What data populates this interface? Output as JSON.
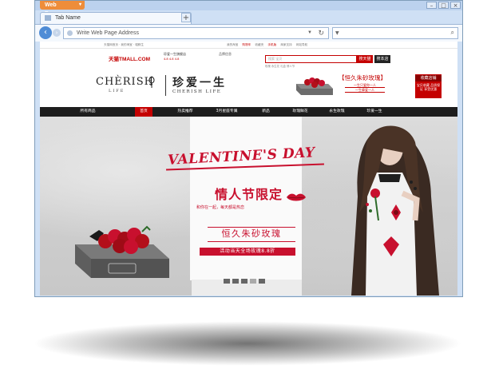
{
  "browser": {
    "app_title": "Web Browser",
    "tab_title": "Tab Name",
    "new_tab": "+",
    "address_placeholder": "Write Web Page Address"
  },
  "site": {
    "topbar_left": "天猫网首页 · 我的淘宝 · 喵鲜生",
    "topbar_right": [
      "我的淘宝",
      "购物车",
      "收藏夹",
      "手机版",
      "商家支持",
      "网站导航"
    ],
    "tmall_logo": "天猫TMALL.COM",
    "shop_name": "珍爱一生旗舰店",
    "shop_scores": "4.8 4.8 4.8",
    "shop_info": "品牌信息",
    "search_placeholder": "搜索 宝贝",
    "search_all_label": "搜天猫",
    "search_shop_label": "搜本店",
    "hot_words": "玫瑰 永生花 礼盒 情人节",
    "brand_en": "CHÈRISH",
    "brand_life": "LIFE",
    "brand_cn": "珍爱一生",
    "brand_cn_en": "CHERISH LIFE",
    "promo_title": "【恒久朱砂玫瑰】",
    "promo_sub_1": "一生只爱你一人",
    "promo_sub_2": "一生挚爱一人",
    "collect_title": "收藏店铺",
    "collect_sub": "宝贝收藏 品质保证 享受优惠",
    "nav": [
      "所有商品",
      "首页",
      "热卖推荐",
      "3月星座专属",
      "新品",
      "玫瑰鲜花",
      "永生玫瑰",
      "珍爱一生"
    ],
    "nav_active_index": 1
  },
  "hero": {
    "title_en": "VALENTINE'S DAY",
    "title_cn": "情人节限定",
    "tagline": "和你在一起，每天都是热恋",
    "rose_name": "恒久朱砂玫瑰",
    "offer": "活动当天全场玫瑰8.8折",
    "slide_count": 5,
    "active_slide": 4
  },
  "colors": {
    "accent_red": "#c8102e",
    "tmall_red": "#c40000",
    "nav_bg": "#1d1d1d",
    "title_orange": "#ee8d3a"
  }
}
